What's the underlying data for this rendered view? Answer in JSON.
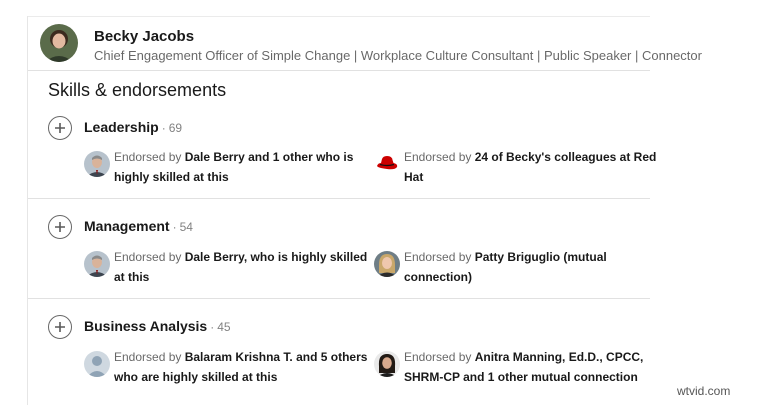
{
  "profile": {
    "name": "Becky Jacobs",
    "headline": "Chief Engagement Officer of Simple Change | Workplace Culture Consultant | Public Speaker | Connector"
  },
  "section": {
    "title": "Skills & endorsements"
  },
  "skills": [
    {
      "name": "Leadership",
      "separator": "·",
      "count": "69",
      "endorsements": [
        {
          "avatar": "man-gray-suit-photo",
          "prefix": "Endorsed by ",
          "bold": "Dale Berry and 1 other who is highly skilled at this"
        },
        {
          "avatar": "red-hat-logo-icon",
          "prefix": "Endorsed by ",
          "bold": "24 of Becky's colleagues at Red Hat"
        }
      ]
    },
    {
      "name": "Management",
      "separator": "·",
      "count": "54",
      "endorsements": [
        {
          "avatar": "man-gray-suit-photo",
          "prefix": "Endorsed by ",
          "bold": "Dale Berry, who is highly skilled at this"
        },
        {
          "avatar": "woman-blonde-photo",
          "prefix": "Endorsed by ",
          "bold": "Patty Briguglio (mutual connection)"
        }
      ]
    },
    {
      "name": "Business Analysis",
      "separator": "·",
      "count": "45",
      "endorsements": [
        {
          "avatar": "default-person-icon",
          "prefix": "Endorsed by ",
          "bold": "Balaram Krishna T. and 5 others who are highly skilled at this"
        },
        {
          "avatar": "woman-dark-hair-photo",
          "prefix": "Endorsed by ",
          "bold": "Anitra Manning, Ed.D., CPCC, SHRM-CP and 1 other mutual connection"
        }
      ]
    }
  ],
  "watermark": "wtvid.com",
  "colors": {
    "redhat": "#cc0000",
    "text_muted": "rgba(0,0,0,0.6)"
  }
}
